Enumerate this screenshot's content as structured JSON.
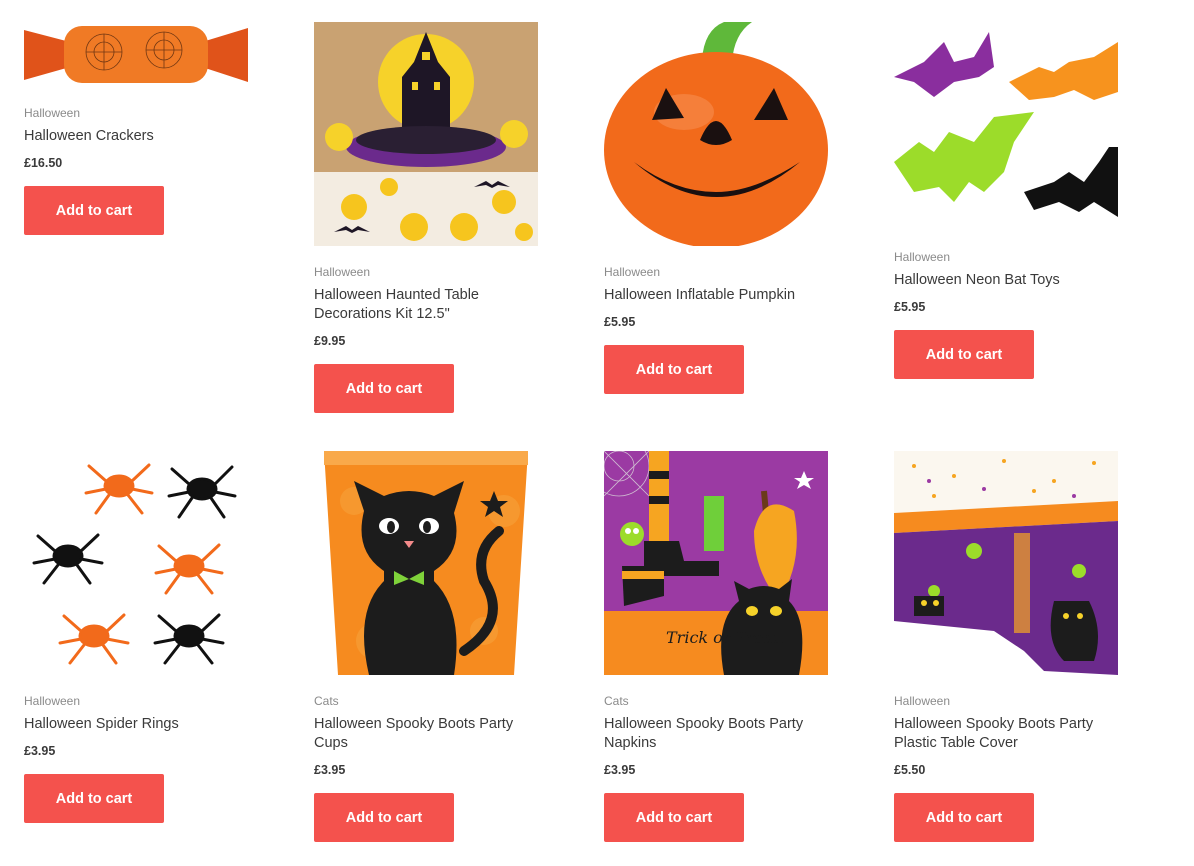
{
  "products": [
    {
      "category": "Halloween",
      "title": "Halloween Crackers",
      "price": "£16.50",
      "button": "Add to cart"
    },
    {
      "category": "Halloween",
      "title": "Halloween Haunted Table Decorations Kit 12.5\"",
      "price": "£9.95",
      "button": "Add to cart"
    },
    {
      "category": "Halloween",
      "title": "Halloween Inflatable Pumpkin",
      "price": "£5.95",
      "button": "Add to cart"
    },
    {
      "category": "Halloween",
      "title": "Halloween Neon Bat Toys",
      "price": "£5.95",
      "button": "Add to cart"
    },
    {
      "category": "Halloween",
      "title": "Halloween Spider Rings",
      "price": "£3.95",
      "button": "Add to cart"
    },
    {
      "category": "Cats",
      "title": "Halloween Spooky Boots Party Cups",
      "price": "£3.95",
      "button": "Add to cart"
    },
    {
      "category": "Cats",
      "title": "Halloween Spooky Boots Party Napkins",
      "price": "£3.95",
      "button": "Add to cart"
    },
    {
      "category": "Halloween",
      "title": "Halloween Spooky Boots Party Plastic Table Cover",
      "price": "£5.50",
      "button": "Add to cart"
    }
  ],
  "napkin_text": "Trick or Treat!",
  "colors": {
    "button": "#f4524d",
    "orange": "#f47a1f",
    "purple": "#7a2f8f",
    "lime": "#9cdc2a"
  }
}
